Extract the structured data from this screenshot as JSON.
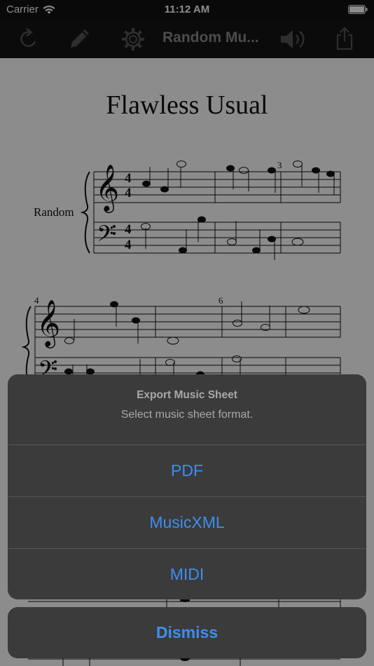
{
  "status_bar": {
    "carrier": "Carrier",
    "time": "11:12 AM"
  },
  "toolbar": {
    "title": "Random Mu...",
    "icons": [
      "refresh-icon",
      "pencil-icon",
      "gear-icon",
      "speaker-icon",
      "share-icon"
    ]
  },
  "sheet": {
    "title": "Flawless Usual",
    "part_name": "Random",
    "measure_numbers": [
      "3",
      "4",
      "6"
    ],
    "time_signature": {
      "top": "4",
      "bottom": "4"
    }
  },
  "export_sheet": {
    "title": "Export Music Sheet",
    "message": "Select music sheet format.",
    "options": [
      "PDF",
      "MusicXML",
      "MIDI"
    ],
    "dismiss": "Dismiss",
    "button_color": "#3d8ef0"
  }
}
